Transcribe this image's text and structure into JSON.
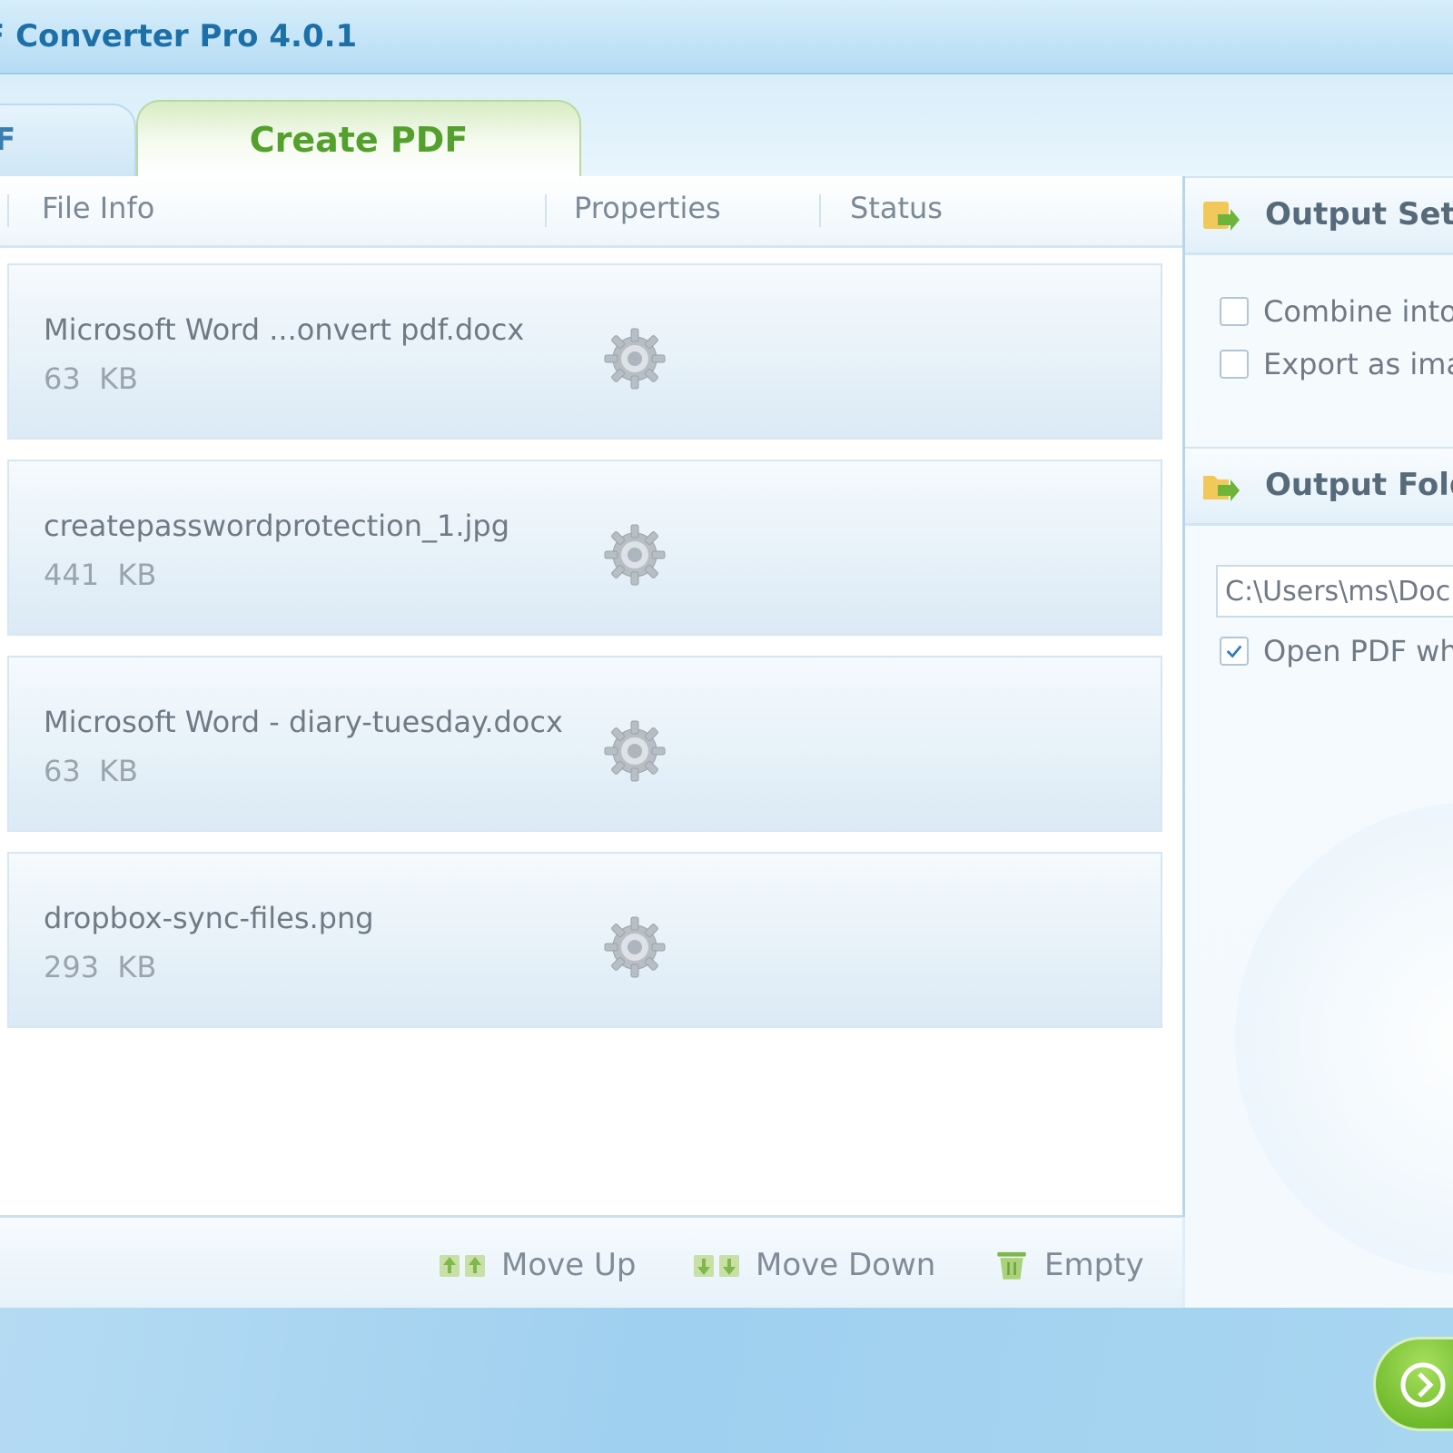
{
  "window": {
    "title": "F Converter Pro 4.0.1"
  },
  "tabs": [
    {
      "label": "F",
      "active": false
    },
    {
      "label": "Create PDF",
      "active": true
    }
  ],
  "file_list": {
    "columns": [
      "File Info",
      "Properties",
      "Status"
    ],
    "rows": [
      {
        "name": "Microsoft Word ...onvert pdf.docx",
        "size": "63  KB",
        "properties_icon": "gear-icon"
      },
      {
        "name": "createpasswordprotection_1.jpg",
        "size": "441  KB",
        "properties_icon": "gear-icon"
      },
      {
        "name": "Microsoft Word - diary-tuesday.docx",
        "size": "63  KB",
        "properties_icon": "gear-icon"
      },
      {
        "name": "dropbox-sync-files.png",
        "size": "293  KB",
        "properties_icon": "gear-icon"
      }
    ]
  },
  "toolbar": {
    "move_up_label": "Move Up",
    "move_down_label": "Move Down",
    "empty_label": "Empty"
  },
  "output_settings": {
    "title": "Output Sett",
    "options": [
      {
        "label": "Combine into",
        "checked": false
      },
      {
        "label": "Export as ima",
        "checked": false
      }
    ]
  },
  "output_folder": {
    "title": "Output Fold",
    "path": "C:\\Users\\ms\\Doc",
    "open_pdf_label": "Open PDF wh",
    "open_pdf_checked": true
  },
  "colors": {
    "accent_blue": "#1d6fa8",
    "accent_green": "#53a02c",
    "text_gray": "#6f7a84"
  }
}
